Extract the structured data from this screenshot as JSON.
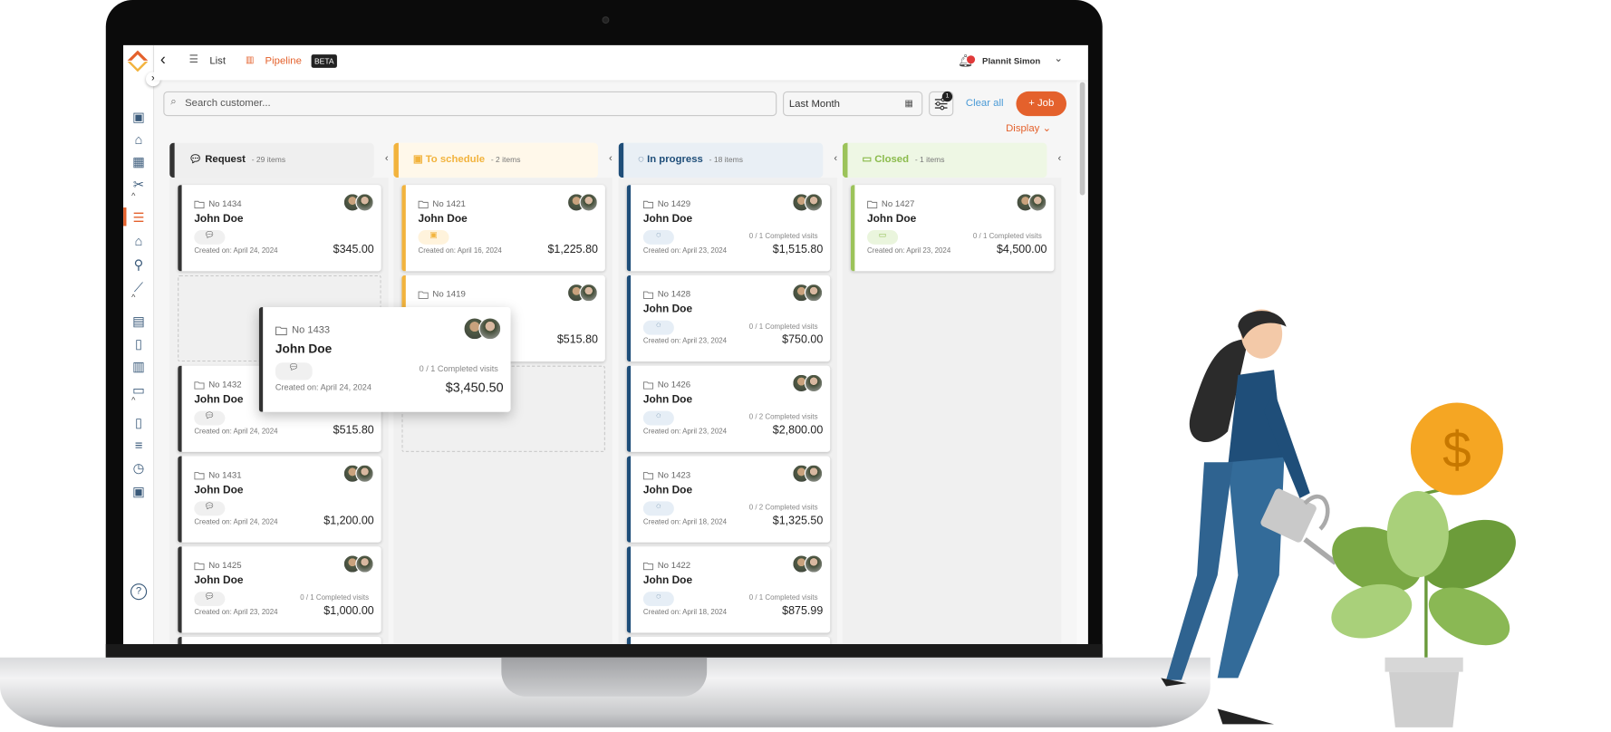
{
  "topbar": {
    "list_label": "List",
    "pipeline_label": "Pipeline",
    "beta_badge": "BETA",
    "user_name": "Plannit Simon"
  },
  "toolbar": {
    "search_placeholder": "Search customer...",
    "date_filter": "Last Month",
    "filter_count": "1",
    "clear_all": "Clear all",
    "add_job": "+ Job",
    "display": "Display"
  },
  "colors": {
    "accent": "#e4612c",
    "request": "#333333",
    "to_schedule": "#f2b33d",
    "in_progress": "#1f4e79",
    "closed": "#9cc35a"
  },
  "columns": [
    {
      "title": "Request",
      "count": "- 29 items",
      "icon": "chat-icon",
      "cards": [
        {
          "no": "No 1434",
          "name": "John Doe",
          "created": "Created on: April 24, 2024",
          "amount": "$345.00"
        },
        {
          "no": "No 1432",
          "name": "John Doe",
          "created": "Created on: April 24, 2024",
          "amount": "$515.80"
        },
        {
          "no": "No 1431",
          "name": "John Doe",
          "created": "Created on: April 24, 2024",
          "amount": "$1,200.00"
        },
        {
          "no": "No 1425",
          "name": "John Doe",
          "created": "Created on: April 23, 2024",
          "amount": "$1,000.00",
          "visits": "0 / 1 Completed visits"
        }
      ]
    },
    {
      "title": "To schedule",
      "count": "- 2 items",
      "icon": "calendar-icon",
      "cards": [
        {
          "no": "No 1421",
          "name": "John Doe",
          "created": "Created on: April 16, 2024",
          "amount": "$1,225.80"
        },
        {
          "no": "No 1419",
          "name": "",
          "created": "",
          "amount": "$515.80"
        }
      ]
    },
    {
      "title": "In progress",
      "count": "- 18 items",
      "icon": "progress-icon",
      "cards": [
        {
          "no": "No 1429",
          "name": "John Doe",
          "created": "Created on: April 23, 2024",
          "amount": "$1,515.80",
          "visits": "0 / 1 Completed visits"
        },
        {
          "no": "No 1428",
          "name": "John Doe",
          "created": "Created on: April 23, 2024",
          "amount": "$750.00",
          "visits": "0 / 1 Completed visits"
        },
        {
          "no": "No 1426",
          "name": "John Doe",
          "created": "Created on: April 23, 2024",
          "amount": "$2,800.00",
          "visits": "0 / 2 Completed visits"
        },
        {
          "no": "No 1423",
          "name": "John Doe",
          "created": "Created on: April 18, 2024",
          "amount": "$1,325.50",
          "visits": "0 / 2 Completed visits"
        },
        {
          "no": "No 1422",
          "name": "John Doe",
          "created": "Created on: April 18, 2024",
          "amount": "$875.99",
          "visits": "0 / 1 Completed visits"
        }
      ]
    },
    {
      "title": "Closed",
      "count": "- 1 items",
      "icon": "folder-icon",
      "cards": [
        {
          "no": "No 1427",
          "name": "John Doe",
          "created": "Created on: April 23, 2024",
          "amount": "$4,500.00",
          "visits": "0 / 1 Completed visits"
        }
      ]
    }
  ],
  "dragged_card": {
    "no": "No 1433",
    "name": "John Doe",
    "created": "Created on: April 24, 2024",
    "amount": "$3,450.50",
    "visits": "0 / 1 Completed visits"
  }
}
